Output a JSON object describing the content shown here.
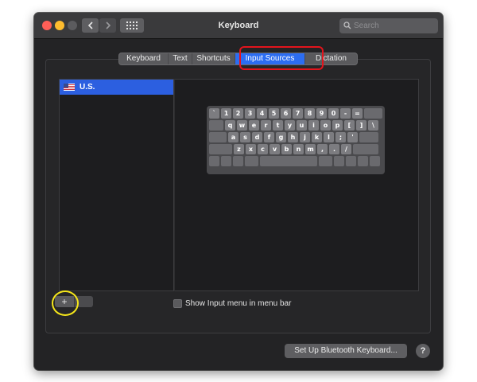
{
  "window": {
    "title": "Keyboard",
    "search_placeholder": "Search"
  },
  "icons": {
    "back": "chevron-left-icon",
    "forward": "chevron-right-icon",
    "grid": "grid-icon",
    "search": "search-icon",
    "flag": "us-flag-icon"
  },
  "tabs": [
    {
      "label": "Keyboard",
      "active": false
    },
    {
      "label": "Text",
      "active": false
    },
    {
      "label": "Shortcuts",
      "active": false
    },
    {
      "label": "Input Sources",
      "active": true
    },
    {
      "label": "Dictation",
      "active": false
    }
  ],
  "input_sources": [
    {
      "label": "U.S.",
      "selected": true
    }
  ],
  "keyboard_rows": [
    [
      "`",
      "1",
      "2",
      "3",
      "4",
      "5",
      "6",
      "7",
      "8",
      "9",
      "0",
      "-",
      "="
    ],
    [
      "q",
      "w",
      "e",
      "r",
      "t",
      "y",
      "u",
      "i",
      "o",
      "p",
      "[",
      "]",
      "\\"
    ],
    [
      "a",
      "s",
      "d",
      "f",
      "g",
      "h",
      "j",
      "k",
      "l",
      ";",
      "'"
    ],
    [
      "z",
      "x",
      "c",
      "v",
      "b",
      "n",
      "m",
      ",",
      ".",
      "/"
    ]
  ],
  "list_controls": {
    "add_label": "+"
  },
  "options": {
    "show_input_menu_label": "Show Input menu in menu bar",
    "show_input_menu_checked": false
  },
  "footer": {
    "bluetooth_button_label": "Set Up Bluetooth Keyboard...",
    "help_label": "?"
  },
  "colors": {
    "accent": "#2c6df2",
    "highlight_red": "#e3141c",
    "highlight_yellow": "#f5e61a"
  }
}
